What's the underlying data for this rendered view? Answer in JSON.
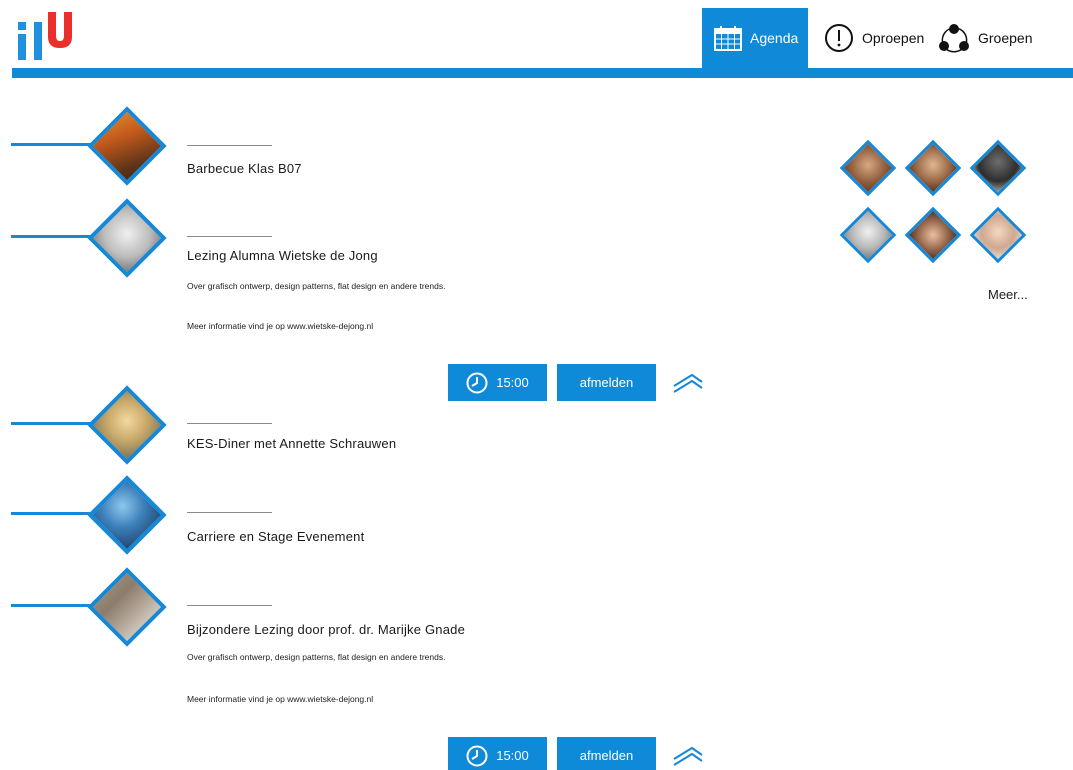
{
  "header": {
    "logo_text": "HU",
    "nav": [
      {
        "label": "Agenda",
        "icon": "calendar-icon",
        "active": true
      },
      {
        "label": "Oproepen",
        "icon": "exclamation-circle-icon",
        "active": false
      },
      {
        "label": "Groepen",
        "icon": "group-network-icon",
        "active": false
      }
    ]
  },
  "colors": {
    "accent": "#0f8ad9",
    "logo_red": "#e8312b"
  },
  "agenda": {
    "items": [
      {
        "title": "Barbecue Klas B07",
        "image": "barbecue-photo"
      },
      {
        "title": "Lezing Alumna Wietske de Jong",
        "image": "woman-portrait-photo",
        "description": "Over grafisch ontwerp, design patterns, flat design en andere trends.",
        "more_info": "Meer informatie vind je op www.wietske-dejong.nl",
        "time": "15:00",
        "action": "afmelden"
      },
      {
        "title": "KES-Diner met Annette Schrauwen",
        "image": "blonde-woman-photo"
      },
      {
        "title": "Carriere en Stage Evenement",
        "image": "network-touch-photo"
      },
      {
        "title": "Bijzondere Lezing door prof. dr. Marijke Gnade",
        "image": "archaeology-photo",
        "description": "Over grafisch ontwerp, design patterns, flat design en andere trends.",
        "more_info": "Meer informatie vind je op www.wietske-dejong.nl",
        "time": "15:00",
        "action": "afmelden"
      }
    ]
  },
  "attendees": {
    "avatars": [
      "avatar-1",
      "avatar-2",
      "avatar-3",
      "avatar-4",
      "avatar-5",
      "avatar-6"
    ],
    "more_label": "Meer..."
  }
}
